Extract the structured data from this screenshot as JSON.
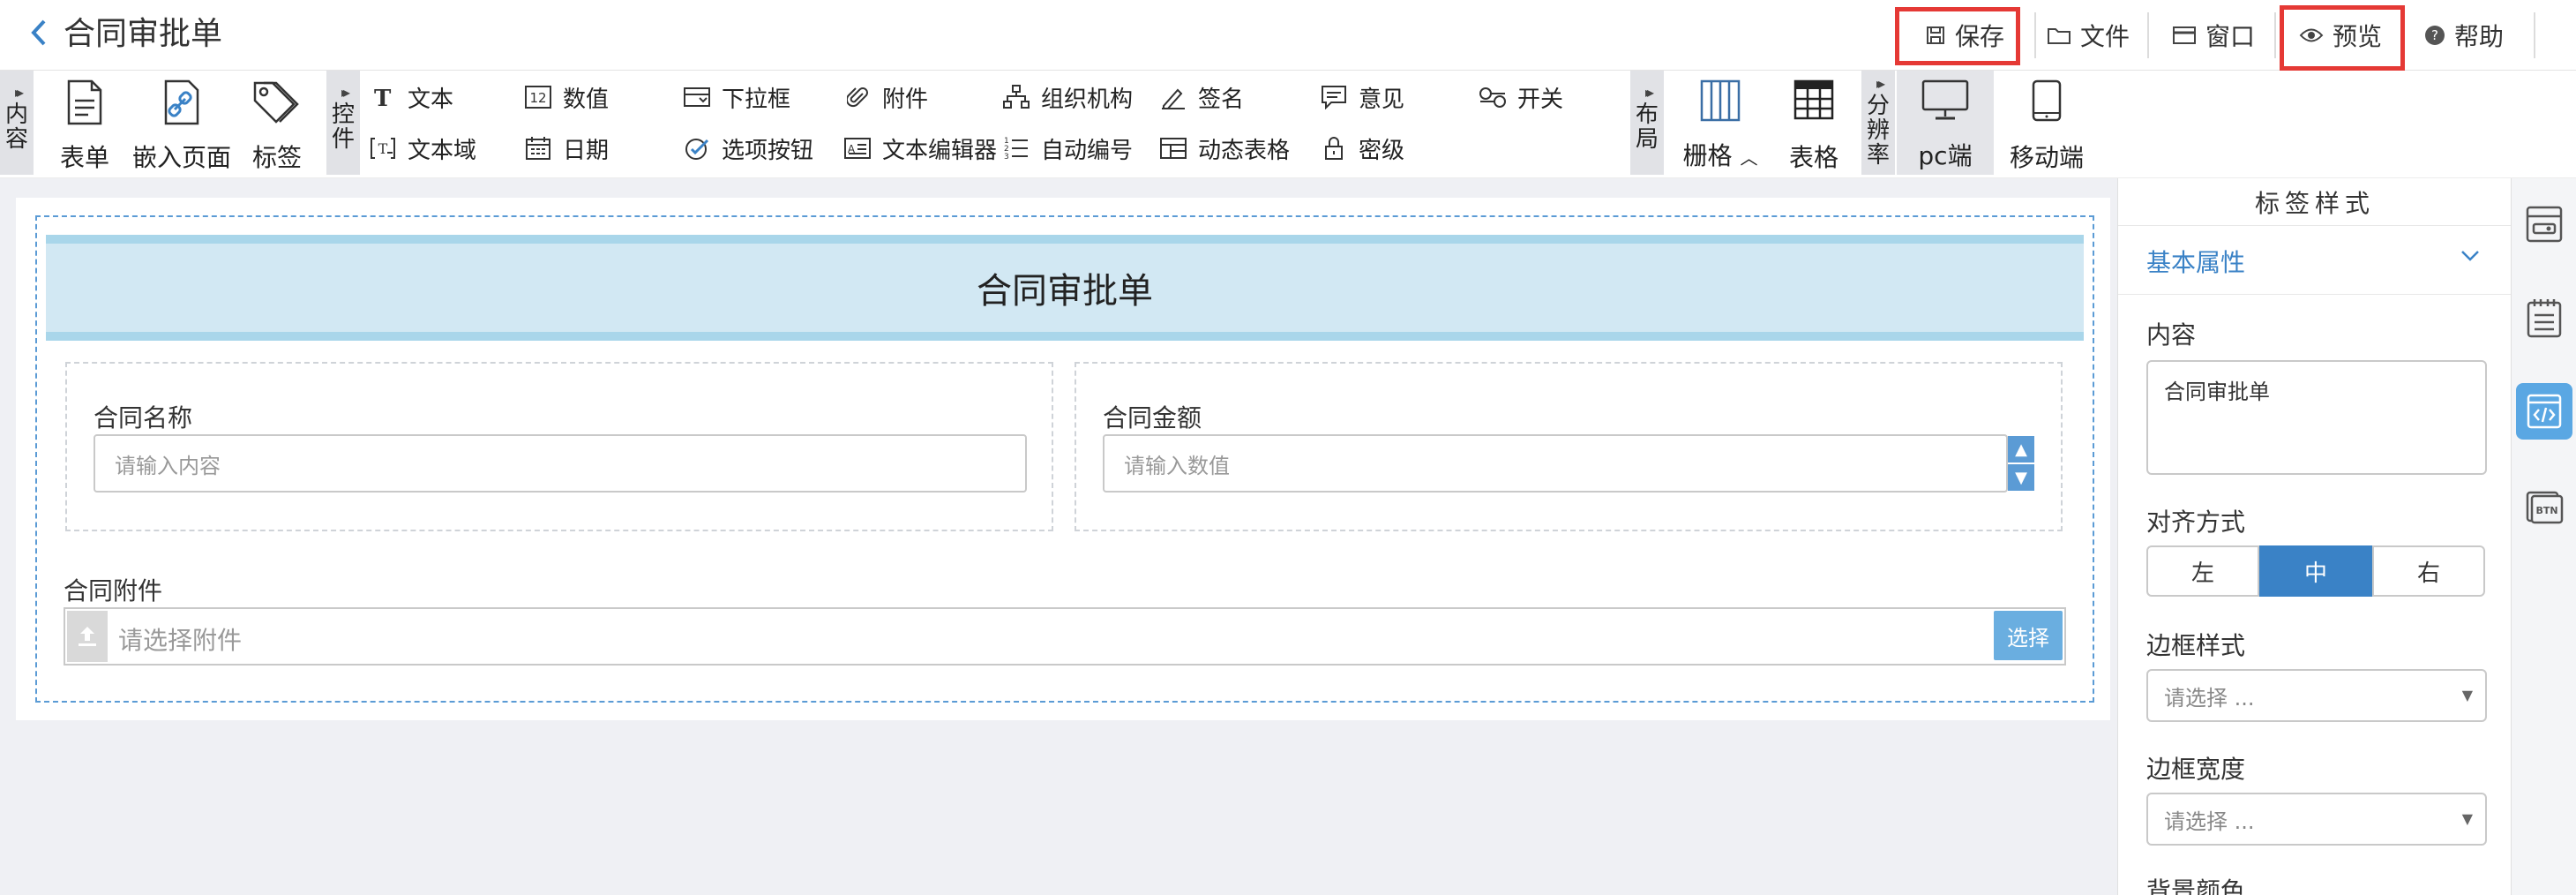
{
  "header": {
    "back_icon": "chevron-left-icon",
    "title": "合同审批单",
    "actions": [
      {
        "label": "保存",
        "icon": "save-icon"
      },
      {
        "label": "文件",
        "icon": "folder-icon"
      },
      {
        "label": "窗口",
        "icon": "window-icon"
      },
      {
        "label": "预览",
        "icon": "eye-icon"
      },
      {
        "label": "帮助",
        "icon": "help-icon"
      }
    ]
  },
  "toolbar": {
    "sections": {
      "content": "内容",
      "controls": "控件",
      "layout": "布局",
      "resolution": "分辨率"
    },
    "content_tools": [
      {
        "label": "表单",
        "icon": "form-icon"
      },
      {
        "label": "嵌入页面",
        "icon": "embed-link-icon"
      },
      {
        "label": "标签",
        "icon": "tag-icon"
      }
    ],
    "controls_row1": [
      {
        "label": "文本",
        "icon": "text-icon"
      },
      {
        "label": "数值",
        "icon": "number-icon"
      },
      {
        "label": "下拉框",
        "icon": "dropdown-icon"
      },
      {
        "label": "附件",
        "icon": "paperclip-icon"
      },
      {
        "label": "组织机构",
        "icon": "org-icon"
      },
      {
        "label": "签名",
        "icon": "signature-icon"
      },
      {
        "label": "意见",
        "icon": "comment-icon"
      },
      {
        "label": "开关",
        "icon": "switch-icon"
      }
    ],
    "controls_row2": [
      {
        "label": "文本域",
        "icon": "textarea-icon"
      },
      {
        "label": "日期",
        "icon": "calendar-icon"
      },
      {
        "label": "选项按钮",
        "icon": "radio-icon"
      },
      {
        "label": "文本编辑器",
        "icon": "editor-icon"
      },
      {
        "label": "自动编号",
        "icon": "list-number-icon"
      },
      {
        "label": "动态表格",
        "icon": "dynamic-table-icon"
      },
      {
        "label": "密级",
        "icon": "lock-icon"
      }
    ],
    "layout_tools": [
      {
        "label": "栅格",
        "icon": "grid-columns-icon"
      },
      {
        "label": "表格",
        "icon": "table-icon"
      }
    ],
    "resolution_tools": [
      {
        "label": "pc端",
        "icon": "desktop-icon"
      },
      {
        "label": "移动端",
        "icon": "tablet-icon"
      }
    ]
  },
  "form": {
    "banner_title": "合同审批单",
    "name_label": "合同名称",
    "name_placeholder": "请输入内容",
    "amount_label": "合同金额",
    "amount_placeholder": "请输入数值",
    "attach_label": "合同附件",
    "attach_placeholder": "请选择附件",
    "attach_button": "选择"
  },
  "panel": {
    "title": "标签样式",
    "section": "基本属性",
    "content_label": "内容",
    "content_value": "合同审批单",
    "align_label": "对齐方式",
    "align_options": [
      "左",
      "中",
      "右"
    ],
    "align_selected": "中",
    "border_style_label": "边框样式",
    "border_style_placeholder": "请选择 ...",
    "border_width_label": "边框宽度",
    "border_width_placeholder": "请选择 ...",
    "bg_color_label": "背景颜色"
  },
  "colors": {
    "accent": "#3a82c6",
    "highlight": "#e53935",
    "banner": "#d2e8f3"
  }
}
